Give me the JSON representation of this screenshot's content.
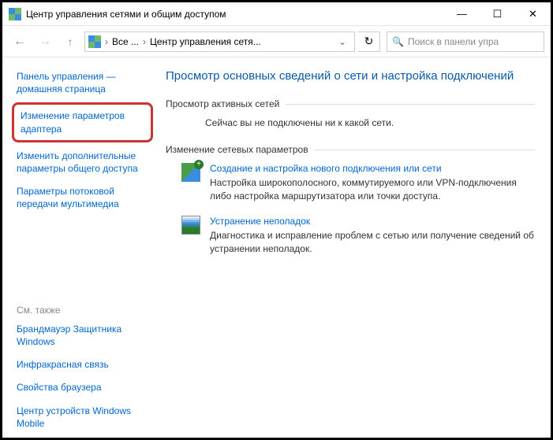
{
  "window": {
    "title": "Центр управления сетями и общим доступом"
  },
  "breadcrumb": {
    "seg1": "Все ...",
    "seg2": "Центр управления сетя..."
  },
  "search": {
    "placeholder": "Поиск в панели упра"
  },
  "sidebar": {
    "link1": "Панель управления — домашняя страница",
    "link2": "Изменение параметров адаптера",
    "link3": "Изменить дополнительные параметры общего доступа",
    "link4": "Параметры потоковой передачи мультимедиа",
    "seeAlsoLabel": "См. также",
    "see1": "Брандмауэр Защитника Windows",
    "see2": "Инфракрасная связь",
    "see3": "Свойства браузера",
    "see4": "Центр устройств Windows Mobile"
  },
  "main": {
    "heading": "Просмотр основных сведений о сети и настройка подключений",
    "activeTitle": "Просмотр активных сетей",
    "activeBody": "Сейчас вы не подключены ни к какой сети.",
    "changeTitle": "Изменение сетевых параметров",
    "action1": {
      "title": "Создание и настройка нового подключения или сети",
      "desc": "Настройка широкополосного, коммутируемого или VPN-подключения либо настройка маршрутизатора или точки доступа."
    },
    "action2": {
      "title": "Устранение неполадок",
      "desc": "Диагностика и исправление проблем с сетью или получение сведений об устранении неполадок."
    }
  }
}
